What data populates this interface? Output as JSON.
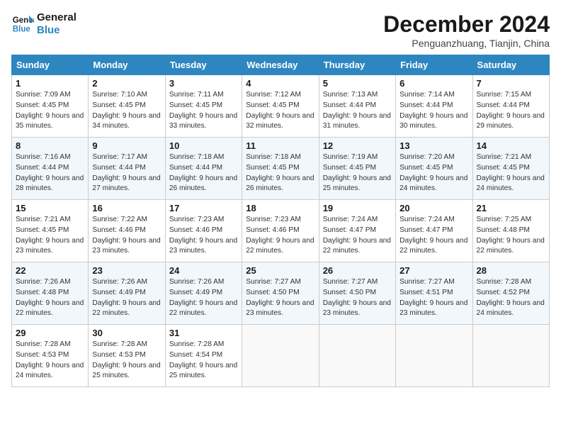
{
  "logo": {
    "line1": "General",
    "line2": "Blue"
  },
  "title": "December 2024",
  "location": "Penguanzhuang, Tianjin, China",
  "days_of_week": [
    "Sunday",
    "Monday",
    "Tuesday",
    "Wednesday",
    "Thursday",
    "Friday",
    "Saturday"
  ],
  "weeks": [
    [
      {
        "num": "1",
        "sunrise": "7:09 AM",
        "sunset": "4:45 PM",
        "daylight": "9 hours and 35 minutes."
      },
      {
        "num": "2",
        "sunrise": "7:10 AM",
        "sunset": "4:45 PM",
        "daylight": "9 hours and 34 minutes."
      },
      {
        "num": "3",
        "sunrise": "7:11 AM",
        "sunset": "4:45 PM",
        "daylight": "9 hours and 33 minutes."
      },
      {
        "num": "4",
        "sunrise": "7:12 AM",
        "sunset": "4:45 PM",
        "daylight": "9 hours and 32 minutes."
      },
      {
        "num": "5",
        "sunrise": "7:13 AM",
        "sunset": "4:44 PM",
        "daylight": "9 hours and 31 minutes."
      },
      {
        "num": "6",
        "sunrise": "7:14 AM",
        "sunset": "4:44 PM",
        "daylight": "9 hours and 30 minutes."
      },
      {
        "num": "7",
        "sunrise": "7:15 AM",
        "sunset": "4:44 PM",
        "daylight": "9 hours and 29 minutes."
      }
    ],
    [
      {
        "num": "8",
        "sunrise": "7:16 AM",
        "sunset": "4:44 PM",
        "daylight": "9 hours and 28 minutes."
      },
      {
        "num": "9",
        "sunrise": "7:17 AM",
        "sunset": "4:44 PM",
        "daylight": "9 hours and 27 minutes."
      },
      {
        "num": "10",
        "sunrise": "7:18 AM",
        "sunset": "4:44 PM",
        "daylight": "9 hours and 26 minutes."
      },
      {
        "num": "11",
        "sunrise": "7:18 AM",
        "sunset": "4:45 PM",
        "daylight": "9 hours and 26 minutes."
      },
      {
        "num": "12",
        "sunrise": "7:19 AM",
        "sunset": "4:45 PM",
        "daylight": "9 hours and 25 minutes."
      },
      {
        "num": "13",
        "sunrise": "7:20 AM",
        "sunset": "4:45 PM",
        "daylight": "9 hours and 24 minutes."
      },
      {
        "num": "14",
        "sunrise": "7:21 AM",
        "sunset": "4:45 PM",
        "daylight": "9 hours and 24 minutes."
      }
    ],
    [
      {
        "num": "15",
        "sunrise": "7:21 AM",
        "sunset": "4:45 PM",
        "daylight": "9 hours and 23 minutes."
      },
      {
        "num": "16",
        "sunrise": "7:22 AM",
        "sunset": "4:46 PM",
        "daylight": "9 hours and 23 minutes."
      },
      {
        "num": "17",
        "sunrise": "7:23 AM",
        "sunset": "4:46 PM",
        "daylight": "9 hours and 23 minutes."
      },
      {
        "num": "18",
        "sunrise": "7:23 AM",
        "sunset": "4:46 PM",
        "daylight": "9 hours and 22 minutes."
      },
      {
        "num": "19",
        "sunrise": "7:24 AM",
        "sunset": "4:47 PM",
        "daylight": "9 hours and 22 minutes."
      },
      {
        "num": "20",
        "sunrise": "7:24 AM",
        "sunset": "4:47 PM",
        "daylight": "9 hours and 22 minutes."
      },
      {
        "num": "21",
        "sunrise": "7:25 AM",
        "sunset": "4:48 PM",
        "daylight": "9 hours and 22 minutes."
      }
    ],
    [
      {
        "num": "22",
        "sunrise": "7:26 AM",
        "sunset": "4:48 PM",
        "daylight": "9 hours and 22 minutes."
      },
      {
        "num": "23",
        "sunrise": "7:26 AM",
        "sunset": "4:49 PM",
        "daylight": "9 hours and 22 minutes."
      },
      {
        "num": "24",
        "sunrise": "7:26 AM",
        "sunset": "4:49 PM",
        "daylight": "9 hours and 22 minutes."
      },
      {
        "num": "25",
        "sunrise": "7:27 AM",
        "sunset": "4:50 PM",
        "daylight": "9 hours and 23 minutes."
      },
      {
        "num": "26",
        "sunrise": "7:27 AM",
        "sunset": "4:50 PM",
        "daylight": "9 hours and 23 minutes."
      },
      {
        "num": "27",
        "sunrise": "7:27 AM",
        "sunset": "4:51 PM",
        "daylight": "9 hours and 23 minutes."
      },
      {
        "num": "28",
        "sunrise": "7:28 AM",
        "sunset": "4:52 PM",
        "daylight": "9 hours and 24 minutes."
      }
    ],
    [
      {
        "num": "29",
        "sunrise": "7:28 AM",
        "sunset": "4:53 PM",
        "daylight": "9 hours and 24 minutes."
      },
      {
        "num": "30",
        "sunrise": "7:28 AM",
        "sunset": "4:53 PM",
        "daylight": "9 hours and 25 minutes."
      },
      {
        "num": "31",
        "sunrise": "7:28 AM",
        "sunset": "4:54 PM",
        "daylight": "9 hours and 25 minutes."
      },
      null,
      null,
      null,
      null
    ]
  ]
}
